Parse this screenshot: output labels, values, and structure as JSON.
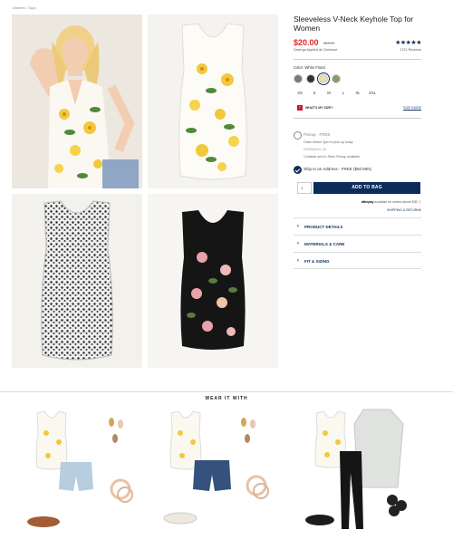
{
  "breadcrumb": "Women / Tops",
  "product": {
    "title": "Sleeveless V-Neck Keyhole Top for Women",
    "price": "$20.00",
    "original_price": "$26.99",
    "savings_note": "Savings Applied at Checkout",
    "stars": "★★★★★",
    "reviews": "1721 Reviews"
  },
  "color": {
    "label": "Color:",
    "value": "White Floral",
    "swatches": [
      "#7a7a7a",
      "#333333",
      "#e8dfa9",
      "#8a9b6b"
    ]
  },
  "sizes": [
    "XS",
    "S",
    "M",
    "L",
    "XL",
    "XXL"
  ],
  "fit": {
    "badge": "T",
    "label": "WHAT'S MY SIZE?",
    "size_guide": "SIZE GUIDE"
  },
  "shipping": {
    "pickup_label": "Pickup · FREE",
    "pickup_line2": "Order before 3pm to pick up today",
    "pickup_line3": "FAIRBANKS, AK",
    "pickup_line4": "Curbside and In-Store Pickup available",
    "ship_label": "Ship to an Address · FREE ($50 MIN)"
  },
  "cart": {
    "qty": "1",
    "add_to_bag": "ADD TO BAG"
  },
  "afterpay": {
    "brand": "afterpay",
    "text": "available for orders above $35"
  },
  "shipping_returns": "SHIPPING & RETURNS",
  "accordion": [
    "PRODUCT DETAILS",
    "MATERIALS & CARE",
    "FIT & SIZING"
  ],
  "wear_it_with": "WEAR IT WITH",
  "colors": {
    "navy": "#0c2d5b",
    "red_price": "#e0262b"
  }
}
